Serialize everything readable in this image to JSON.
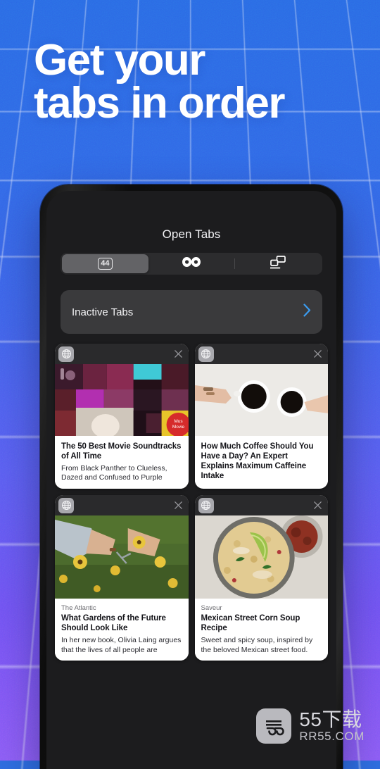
{
  "background": {
    "gradient_top": "#2a6ae4",
    "gradient_bottom": "#8b5cf6",
    "grid_color": "#ffffff"
  },
  "headline": {
    "line1": "Get your",
    "line2": "tabs in order",
    "color": "#ffffff"
  },
  "phone": {
    "screen": {
      "title": "Open Tabs",
      "background": "#1c1c1e",
      "segmented_control": {
        "segments": [
          {
            "name": "normal-tabs",
            "icon": "tab-count-badge",
            "badge": "44",
            "selected": true
          },
          {
            "name": "private-tabs",
            "icon": "private-mask-icon",
            "badge": "",
            "selected": false
          },
          {
            "name": "synced-tabs",
            "icon": "synced-devices-icon",
            "badge": "",
            "selected": false
          }
        ]
      },
      "inactive_tabs": {
        "label": "Inactive Tabs",
        "chevron_icon": "chevron-right-icon",
        "chevron_color": "#3b9cf0"
      },
      "tabs": [
        {
          "favicon": "globe-icon",
          "close_icon": "close-icon",
          "source": "",
          "title": "The 50 Best Movie Soundtracks of All Time",
          "description": "From Black Panther to Clueless, Dazed and Confused to Purple",
          "thumbnail": "movie-collage-thumbnail"
        },
        {
          "favicon": "globe-icon",
          "close_icon": "close-icon",
          "source": "",
          "title": "How Much Coffee Should You Have a Day? An Expert Explains Maximum Caffeine Intake",
          "description": "",
          "thumbnail": "two-coffee-cups-thumbnail"
        },
        {
          "favicon": "globe-icon",
          "close_icon": "close-icon",
          "source": "The Atlantic",
          "title": "What Gardens of the Future Should Look Like",
          "description": "In her new book, Olivia Laing argues that the lives of all people are enriched with",
          "thumbnail": "hands-picking-flowers-thumbnail"
        },
        {
          "favicon": "globe-icon",
          "close_icon": "close-icon",
          "source": "Saveur",
          "title": "Mexican Street Corn Soup Recipe",
          "description": "Sweet and spicy soup, inspired by the beloved Mexican street food.",
          "thumbnail": "corn-soup-bowl-thumbnail"
        }
      ]
    }
  },
  "watermark": {
    "logo_text": "55",
    "main": "55下载",
    "sub": "RR55.COM"
  }
}
